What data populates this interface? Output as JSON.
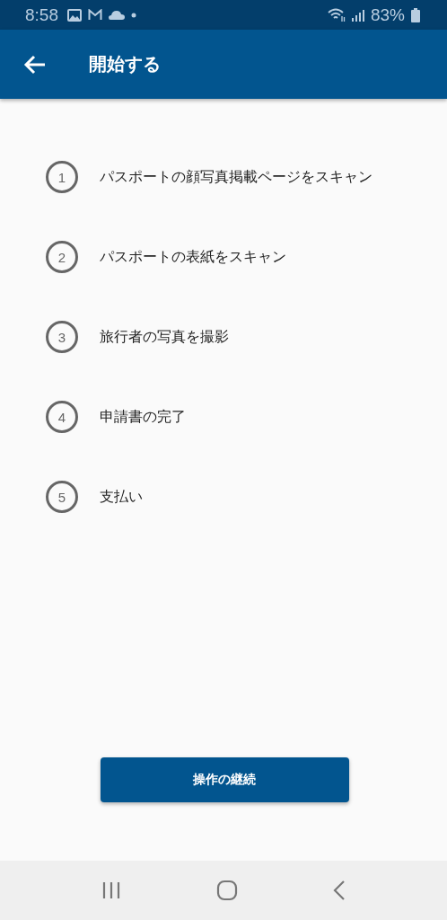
{
  "status_bar": {
    "time": "8:58",
    "battery": "83%"
  },
  "app_bar": {
    "title": "開始する"
  },
  "steps": [
    {
      "number": "1",
      "label": "パスポートの顔写真掲載ページをスキャン"
    },
    {
      "number": "2",
      "label": "パスポートの表紙をスキャン"
    },
    {
      "number": "3",
      "label": "旅行者の写真を撮影"
    },
    {
      "number": "4",
      "label": "申請書の完了"
    },
    {
      "number": "5",
      "label": "支払い"
    }
  ],
  "continue_button": {
    "label": "操作の継続"
  }
}
